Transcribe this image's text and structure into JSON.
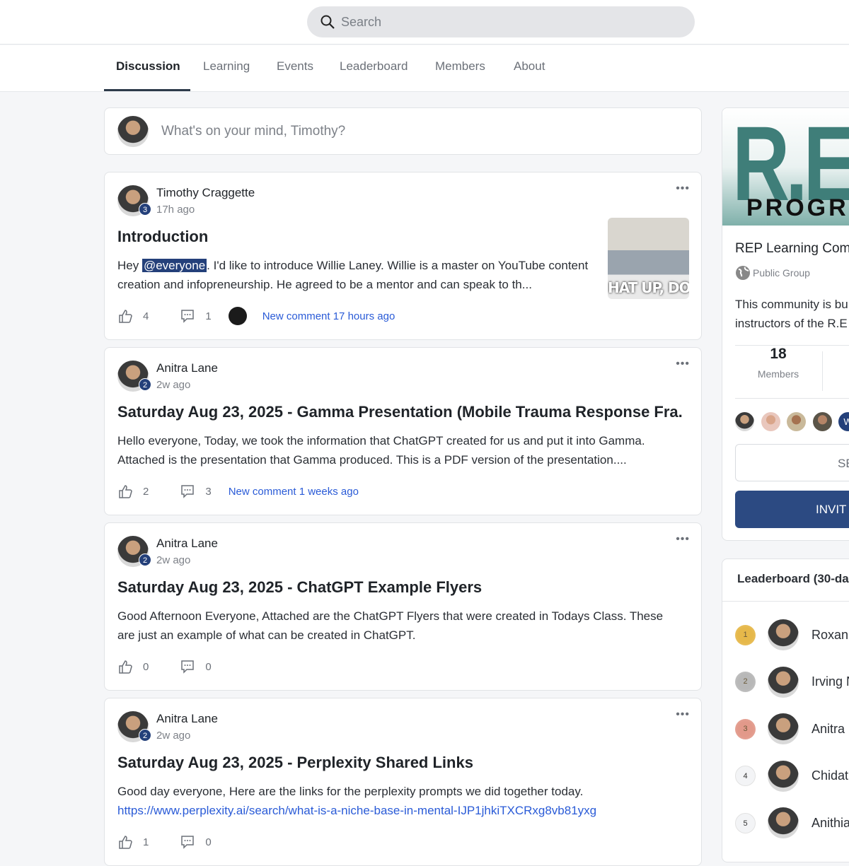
{
  "search": {
    "placeholder": "Search",
    "icon": "search-icon"
  },
  "tabs": [
    "Discussion",
    "Learning",
    "Events",
    "Leaderboard",
    "Members",
    "About"
  ],
  "active_tab": "Discussion",
  "composer": {
    "placeholder": "What's on your mind, Timothy?"
  },
  "posts": [
    {
      "author": "Timothy Craggette",
      "level": "3",
      "time": "17h ago",
      "title": "Introduction",
      "body_pre": "Hey ",
      "mention": "@everyone",
      "body": ". I'd like to introduce Willie Laney. Willie is a master on YouTube content creation and infopreneurship. He agreed to be a mentor and can speak to th...",
      "likes": "4",
      "comments": "1",
      "new_comment": "New comment 17 hours ago",
      "thumbnail_caption": "HAT UP, DOG"
    },
    {
      "author": "Anitra Lane",
      "level": "2",
      "time": "2w ago",
      "title": "Saturday Aug 23, 2025 - Gamma Presentation (Mobile Trauma Response Fra...",
      "body": "Hello everyone, Today, we took the information that ChatGPT created for us and put it into Gamma. Attached is the presentation that Gamma produced. This is a PDF version of the presentation....",
      "likes": "2",
      "comments": "3",
      "new_comment": "New comment 1 weeks ago"
    },
    {
      "author": "Anitra Lane",
      "level": "2",
      "time": "2w ago",
      "title": "Saturday Aug 23, 2025 - ChatGPT Example Flyers",
      "body": "Good Afternoon Everyone, Attached are the ChatGPT Flyers that were created in Todays Class. These are just an example of what can be created in ChatGPT.",
      "likes": "0",
      "comments": "0"
    },
    {
      "author": "Anitra Lane",
      "level": "2",
      "time": "2w ago",
      "title": "Saturday Aug 23, 2025 - Perplexity Shared Links",
      "body": "Good day everyone, Here are the links for the perplexity prompts we did together today.",
      "link": "https://www.perplexity.ai/search/what-is-a-niche-base-in-mental-IJP1jhkiTXCRxg8vb81yxg",
      "likes": "1",
      "comments": "0"
    }
  ],
  "group": {
    "banner_text": "R.E.",
    "banner_sub": "PROGRA",
    "name": "REP Learning Com",
    "type": "Public Group",
    "desc_line1": "This community is bu",
    "desc_line2": "instructors of the R.E",
    "members_count": "18",
    "members_label": "Members",
    "extra_avatar_initial": "W",
    "see_label": "SE",
    "invite_label": "INVIT"
  },
  "leaderboard": {
    "title": "Leaderboard (30-da",
    "rows": [
      {
        "rank": "1",
        "name": "Roxann"
      },
      {
        "rank": "2",
        "name": "Irving N"
      },
      {
        "rank": "3",
        "name": "Anitra l"
      },
      {
        "rank": "4",
        "name": "Chidat"
      },
      {
        "rank": "5",
        "name": "Anithia"
      }
    ]
  },
  "colors": {
    "accent": "#2c4a82",
    "link": "#2a5bd7",
    "gold": "#e6b84a",
    "silver": "#b8b8b8",
    "bronze": "#e2998a"
  }
}
